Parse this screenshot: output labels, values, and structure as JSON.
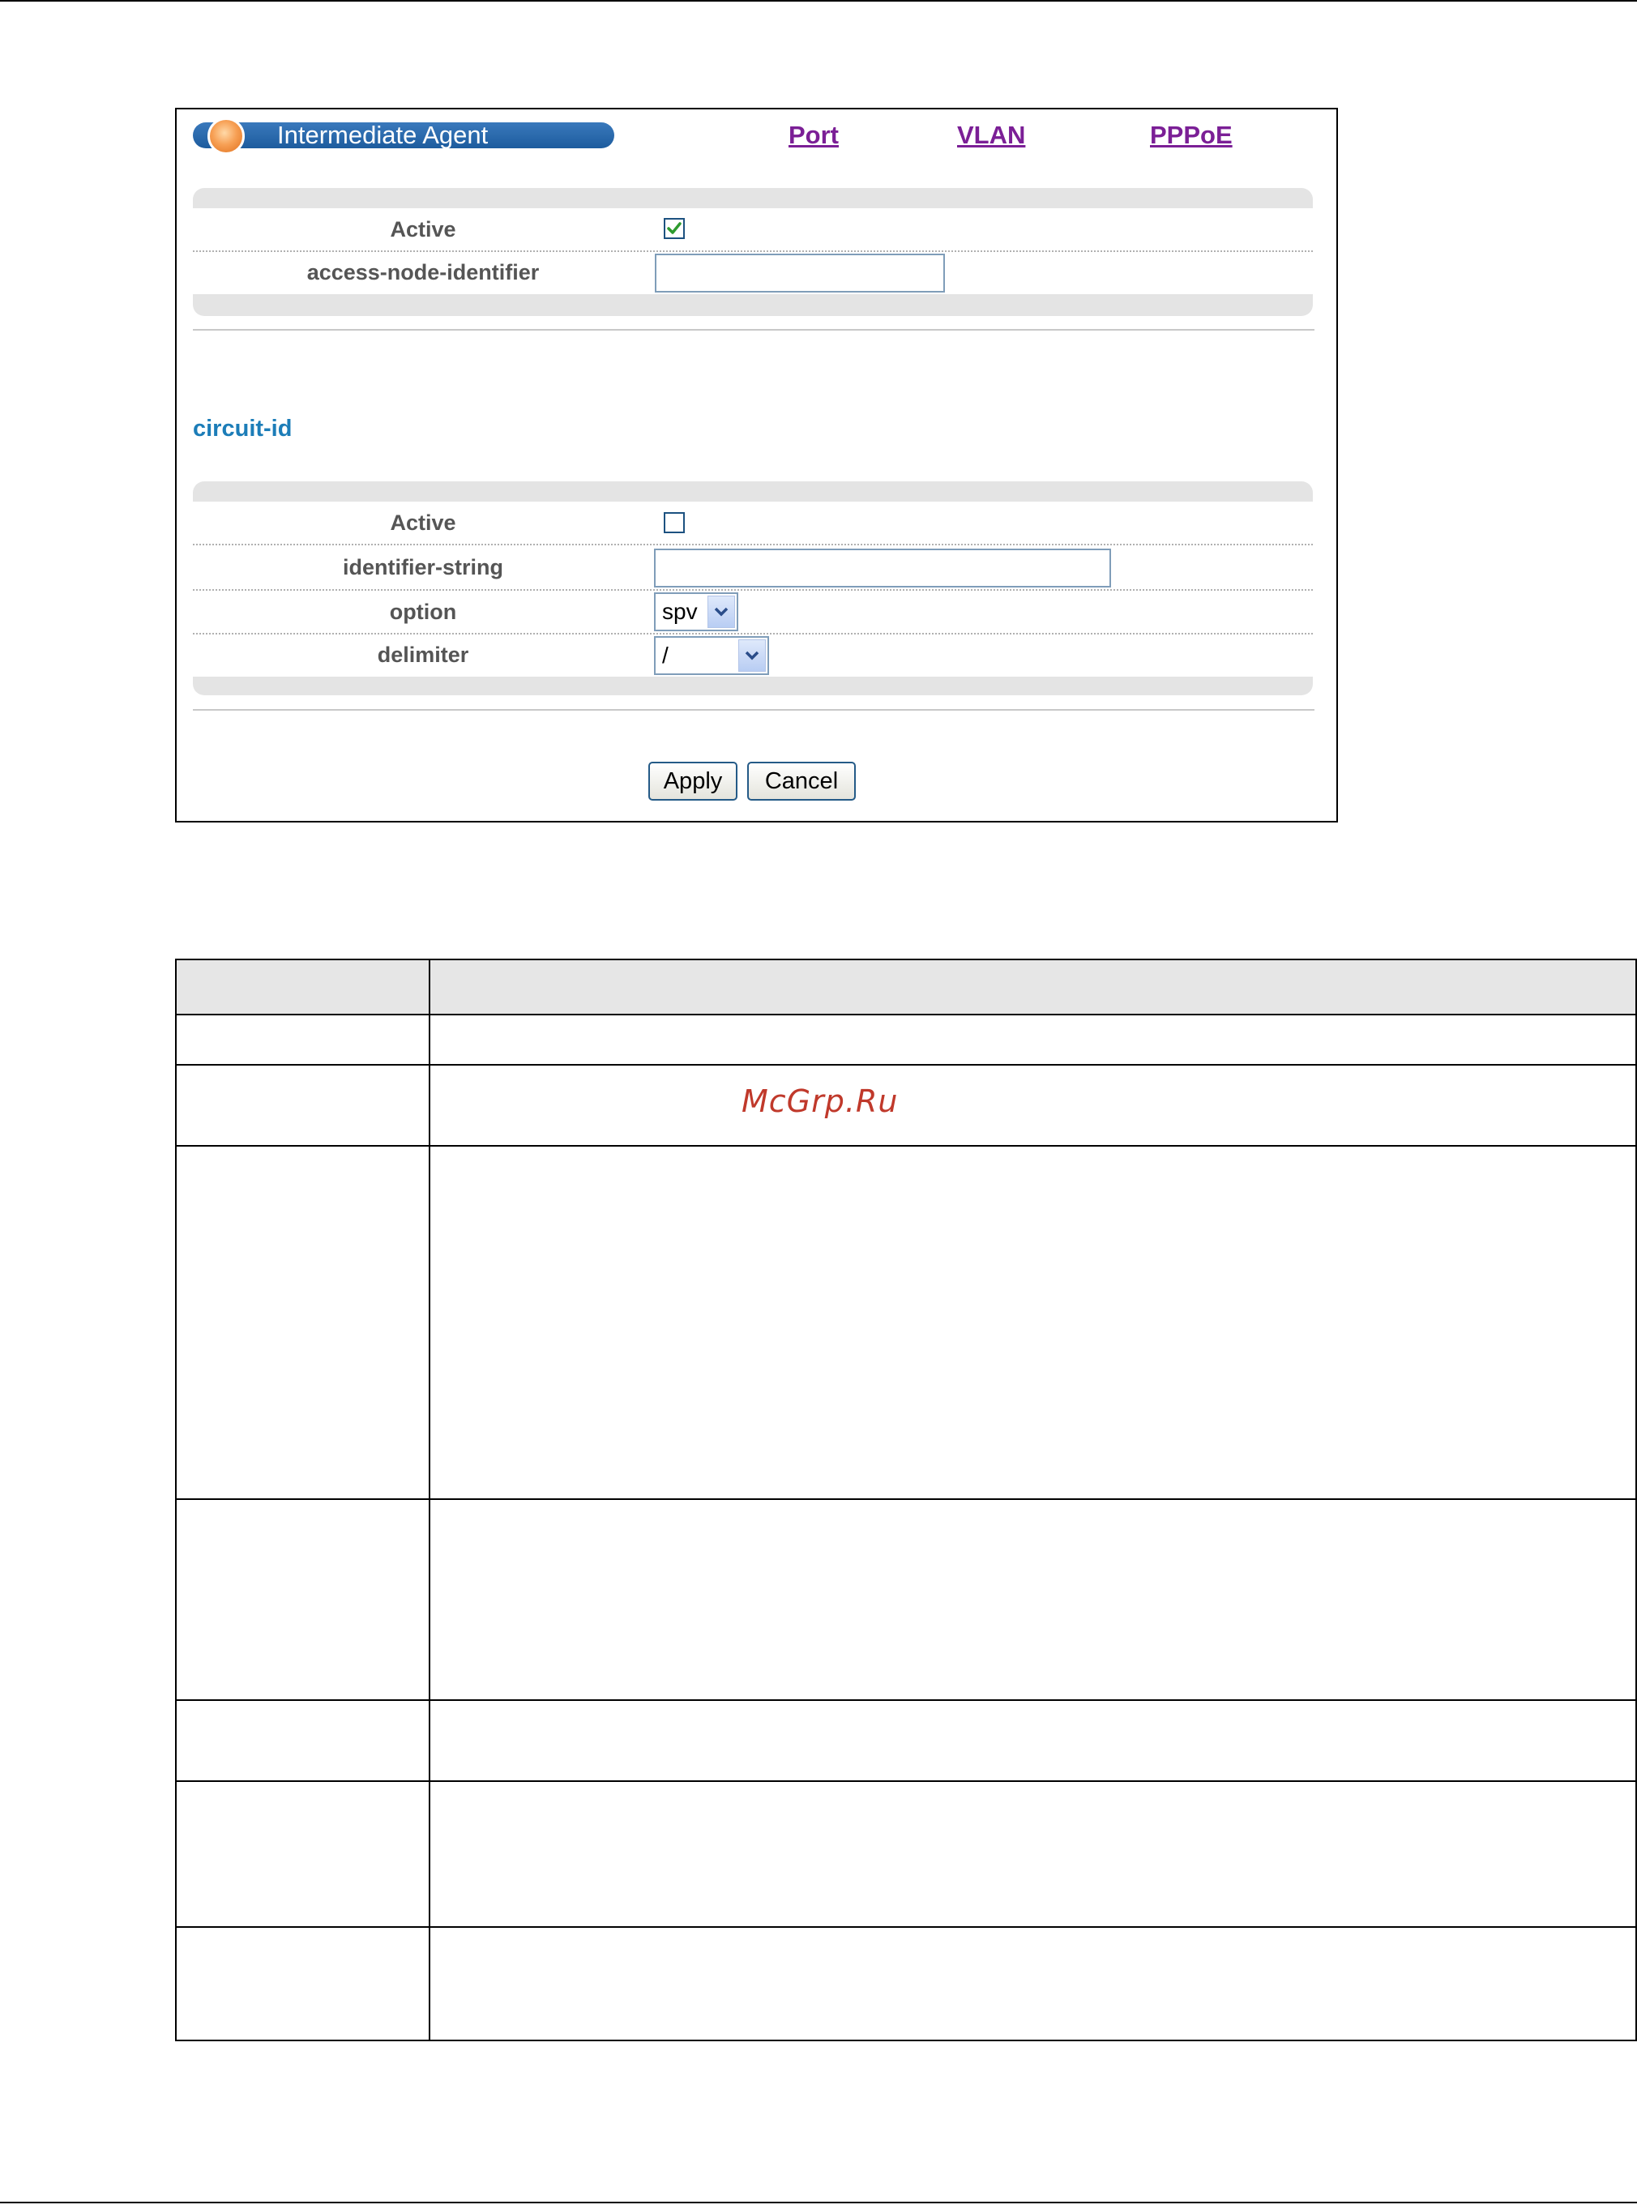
{
  "window": {
    "title": "Intermediate Agent",
    "tabs": [
      {
        "label": "Port"
      },
      {
        "label": "VLAN"
      },
      {
        "label": "PPPoE"
      }
    ]
  },
  "agent_panel": {
    "active_label": "Active",
    "active_checked": true,
    "access_node_label": "access-node-identifier",
    "access_node_value": ""
  },
  "circuit_id": {
    "section_title": "circuit-id",
    "active_label": "Active",
    "active_checked": false,
    "identifier_label": "identifier-string",
    "identifier_value": "",
    "option_label": "option",
    "option_value": "spv",
    "delimiter_label": "delimiter",
    "delimiter_value": "/"
  },
  "buttons": {
    "apply": "Apply",
    "cancel": "Cancel"
  },
  "watermark": "McGrp.Ru",
  "colors": {
    "title_bar": "#1d5c9e",
    "link": "#7b1f96",
    "section": "#1c7db8",
    "panel": "#e4e4e4",
    "table_header": "#e6e6e6",
    "check": "#2e9b2e"
  }
}
